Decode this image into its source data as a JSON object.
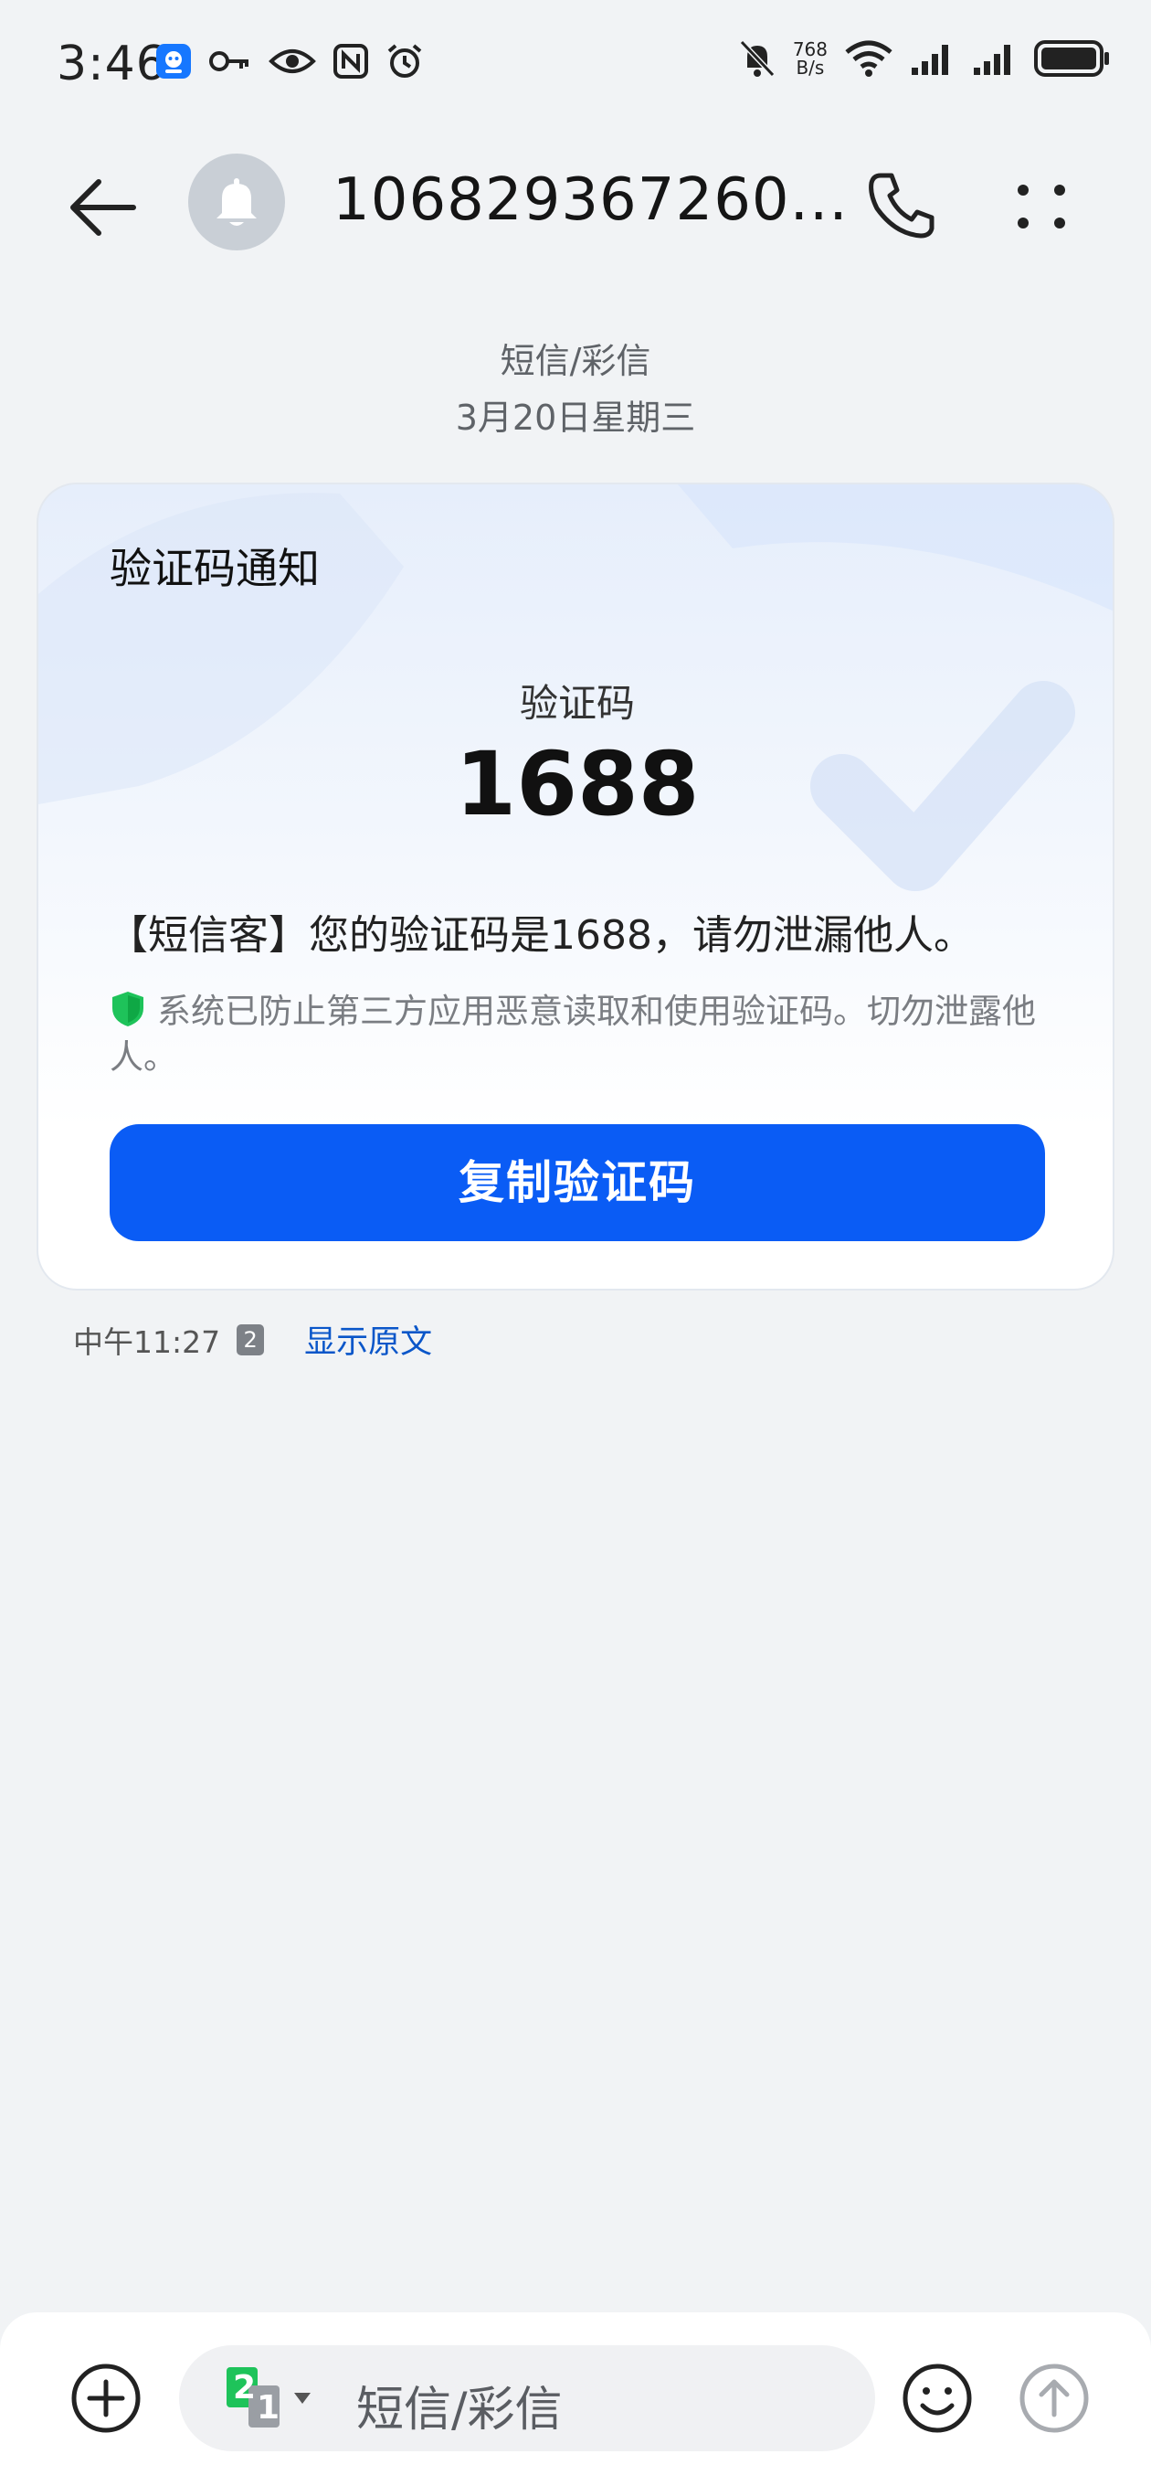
{
  "status_bar": {
    "time": "3:46",
    "net_speed_value": "768",
    "net_speed_unit": "B/s",
    "icons": [
      "app-icon",
      "key-icon",
      "eye-icon",
      "nfc-icon",
      "alarm-icon",
      "mute-bell-icon",
      "wifi-icon",
      "signal-icon",
      "signal-icon",
      "battery-icon"
    ]
  },
  "header": {
    "contact_name": "106829367260...",
    "avatar_icon": "bell-icon"
  },
  "thread": {
    "type_label": "短信/彩信",
    "date_label": "3月20日星期三"
  },
  "card": {
    "title": "验证码通知",
    "code_label": "验证码",
    "code_value": "1688",
    "message": "【短信客】您的验证码是1688，请勿泄漏他人。",
    "security_note": "系统已防止第三方应用恶意读取和使用验证码。切勿泄露他人。",
    "copy_button": "复制验证码"
  },
  "meta": {
    "time": "中午11:27",
    "sim": "2",
    "show_original": "显示原文"
  },
  "compose": {
    "placeholder": "短信/彩信",
    "sim_primary": "2",
    "sim_secondary": "1"
  },
  "colors": {
    "accent": "#0a5cf5",
    "shield_green": "#1ec35a",
    "background": "#f1f3f5"
  }
}
